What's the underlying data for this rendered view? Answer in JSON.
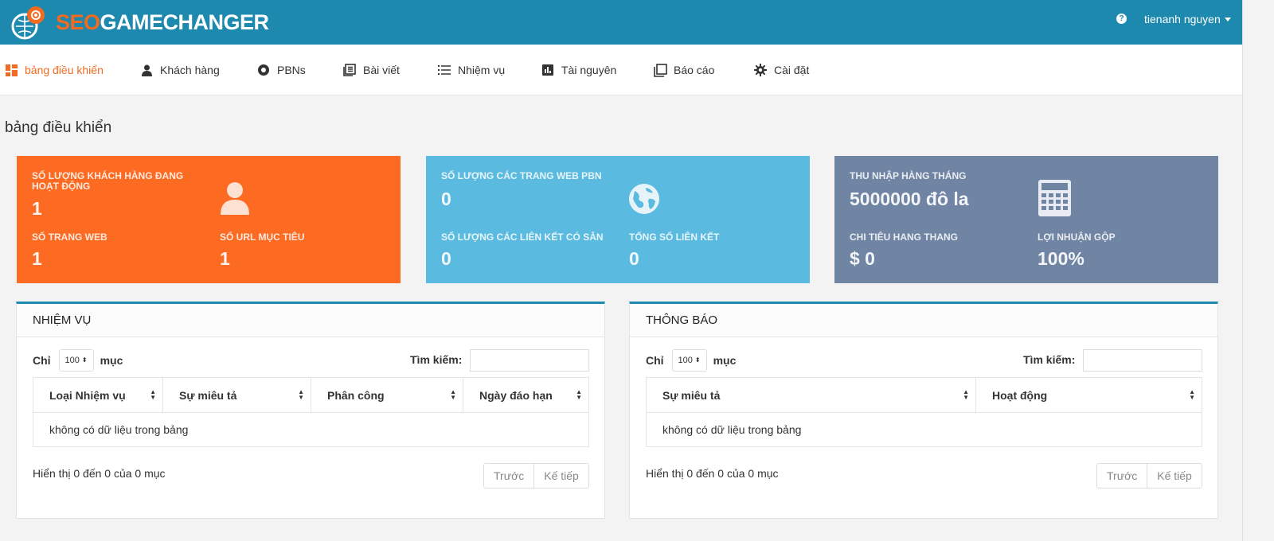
{
  "header": {
    "logo_seo": "SEO",
    "logo_rest": "GAMECHANGER",
    "help": "?",
    "user_name": "tienanh nguyen"
  },
  "nav": {
    "items": [
      {
        "label": "bảng điều khiển",
        "icon": "dashboard-icon",
        "active": true
      },
      {
        "label": "Khách hàng",
        "icon": "user-icon"
      },
      {
        "label": "PBNs",
        "icon": "record-icon"
      },
      {
        "label": "Bài viết",
        "icon": "articles-icon"
      },
      {
        "label": "Nhiệm vụ",
        "icon": "list-icon"
      },
      {
        "label": "Tài nguyên",
        "icon": "bar-chart-icon"
      },
      {
        "label": "Báo cáo",
        "icon": "copy-icon"
      },
      {
        "label": "Cài đặt",
        "icon": "gear-icon"
      }
    ]
  },
  "page": {
    "title": "bảng điều khiển"
  },
  "cards": {
    "orange": {
      "color": "#fd6a21",
      "label1": "SỐ LƯỢNG KHÁCH HÀNG ĐANG HOẠT ĐỘNG",
      "value1": "1",
      "label2": "SỐ TRANG WEB",
      "value2": "1",
      "label3": "SỐ URL MỤC TIÊU",
      "value3": "1",
      "icon": "user-icon"
    },
    "blue": {
      "color": "#5bbadf",
      "label1": "SỐ LƯỢNG CÁC TRANG WEB PBN",
      "value1": "0",
      "label2": "SỐ LƯỢNG CÁC LIÊN KẾT CÓ SẴN",
      "value2": "0",
      "label3": "TỔNG SỐ LIÊN KẾT",
      "value3": "0",
      "icon": "globe-icon"
    },
    "grey": {
      "color": "#7084a4",
      "label1": "THU NHẬP HÀNG THÁNG",
      "value1": "5000000 đô la",
      "label2": "CHI TIÊU HANG THANG",
      "value2": "$ 0",
      "label3": "LỢI NHUẬN GỘP",
      "value3": "100%",
      "icon": "calculator-icon"
    }
  },
  "tasks_panel": {
    "title": "NHIỆM VỤ",
    "show_label": "Chỉ",
    "page_size": "100",
    "entries_label": "mục",
    "search_label": "Tìm kiếm:",
    "search_value": "",
    "columns": [
      "Loại Nhiệm vụ",
      "Sự miêu tả",
      "Phân công",
      "Ngày đáo hạn"
    ],
    "empty_text": "không có dữ liệu trong bảng",
    "info": "Hiển thị 0 đến 0 của 0 mục",
    "prev": "Trước",
    "next": "Kế tiếp"
  },
  "notifications_panel": {
    "title": "THÔNG BÁO",
    "show_label": "Chỉ",
    "page_size": "100",
    "entries_label": "mục",
    "search_label": "Tìm kiếm:",
    "search_value": "",
    "columns": [
      "Sự miêu tả",
      "Hoạt động"
    ],
    "empty_text": "không có dữ liệu trong bảng",
    "info": "Hiển thị 0 đến 0 của 0 mục",
    "prev": "Trước",
    "next": "Kế tiếp"
  }
}
